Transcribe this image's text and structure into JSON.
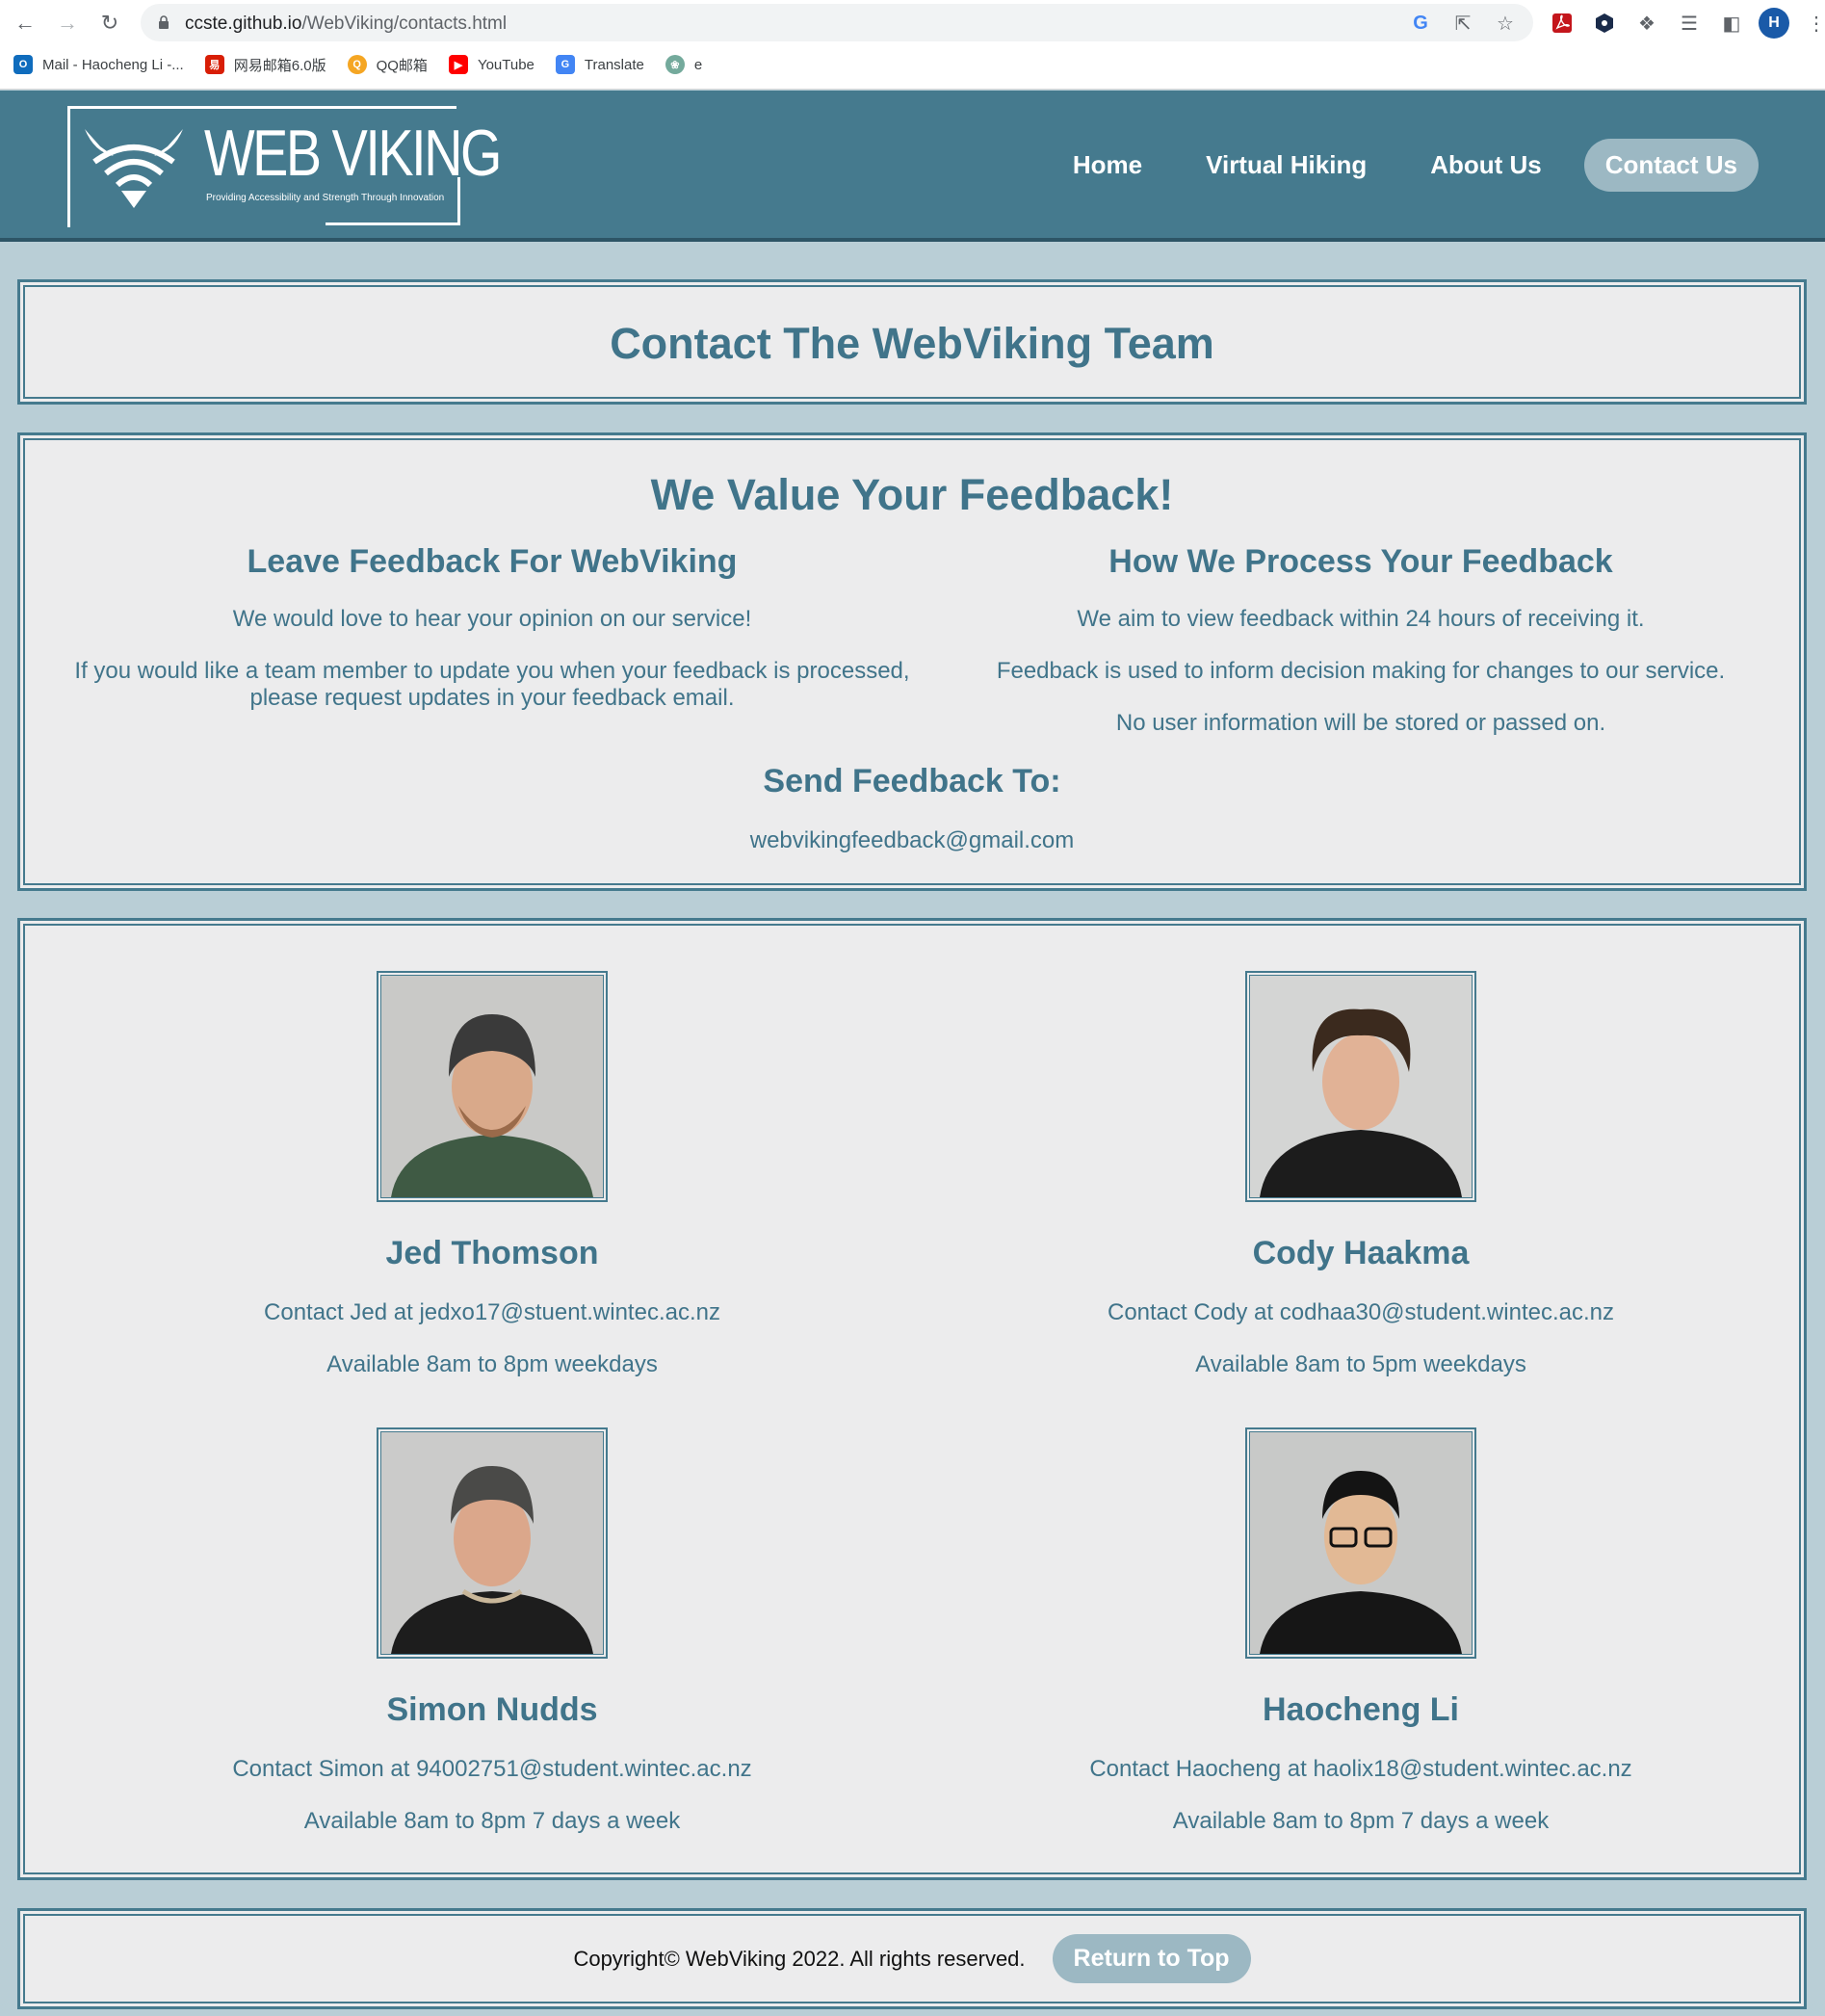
{
  "browser": {
    "url_host": "ccste.github.io",
    "url_path": "/WebViking/contacts.html",
    "bookmarks": [
      {
        "label": "Mail - Haocheng Li -...",
        "icon": "outlook-icon",
        "color": "#0f6cbd"
      },
      {
        "label": "网易邮箱6.0版",
        "icon": "netease-mail-icon",
        "color": "#d81e06"
      },
      {
        "label": "QQ邮箱",
        "icon": "qq-mail-icon",
        "color": "#f5a623"
      },
      {
        "label": "YouTube",
        "icon": "youtube-icon",
        "color": "#ff0000"
      },
      {
        "label": "Translate",
        "icon": "google-translate-icon",
        "color": "#4285f4"
      },
      {
        "label": "e",
        "icon": "chatgpt-icon",
        "color": "#74aa9c"
      }
    ],
    "profile_initial": "H"
  },
  "header": {
    "logo_title": "WEB VIKING",
    "logo_tagline": "Providing Accessibility and Strength Through Innovation",
    "nav": [
      {
        "label": "Home",
        "active": false
      },
      {
        "label": "Virtual Hiking",
        "active": false
      },
      {
        "label": "About Us",
        "active": false
      },
      {
        "label": "Contact Us",
        "active": true
      }
    ]
  },
  "page_title": "Contact The WebViking Team",
  "feedback": {
    "heading": "We Value Your Feedback!",
    "left": {
      "heading": "Leave Feedback For WebViking",
      "paragraphs": [
        "We would love to hear your opinion on our service!",
        "If you would like a team member to update you when your feedback is processed, please request updates in your feedback email."
      ]
    },
    "right": {
      "heading": "How We Process Your Feedback",
      "paragraphs": [
        "We aim to view feedback within 24 hours of receiving it.",
        "Feedback is used to inform decision making for changes to our service.",
        "No user information will be stored or passed on."
      ]
    },
    "send_heading": "Send Feedback To:",
    "send_email": "webvikingfeedback@gmail.com"
  },
  "team": [
    {
      "name": "Jed Thomson",
      "contact": "Contact Jed at jedxo17@stuent.wintec.ac.nz",
      "availability": "Available 8am to 8pm weekdays"
    },
    {
      "name": "Cody Haakma",
      "contact": "Contact Cody at codhaa30@student.wintec.ac.nz",
      "availability": "Available 8am to 5pm weekdays"
    },
    {
      "name": "Simon Nudds",
      "contact": "Contact Simon at 94002751@student.wintec.ac.nz",
      "availability": "Available 8am to 8pm 7 days a week"
    },
    {
      "name": "Haocheng Li",
      "contact": "Contact Haocheng at haolix18@student.wintec.ac.nz",
      "availability": "Available 8am to 8pm 7 days a week"
    }
  ],
  "footer": {
    "copyright": "Copyright© WebViking 2022. All rights reserved.",
    "return_top": "Return to Top"
  },
  "colors": {
    "header_bg": "#457a8e",
    "page_bg": "#b9ced6",
    "panel_bg": "#ececed",
    "text_teal": "#40748a",
    "active_pill": "#9cb8c3"
  }
}
